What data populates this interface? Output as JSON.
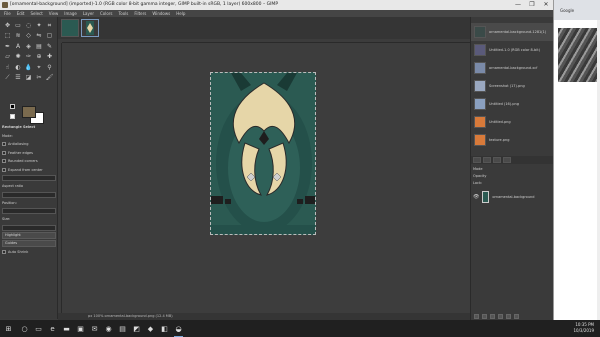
{
  "window": {
    "title": "[ornamental-background] (imported)-1.0 (RGB color 8-bit gamma integer, GIMP built-in sRGB, 1 layer) 600x800 – GIMP",
    "controls": [
      "—",
      "❐",
      "✕"
    ]
  },
  "menubar": {
    "items": [
      "File",
      "Edit",
      "Select",
      "View",
      "Image",
      "Layer",
      "Colors",
      "Tools",
      "Filters",
      "Windows",
      "Help"
    ]
  },
  "colors": {
    "foreground": "#7a6a4e",
    "background": "#ffffff",
    "image_teal": "#2b5a52",
    "image_cream": "#e6d6a8"
  },
  "tool_options": {
    "title": "Rectangle Select",
    "rows": [
      "Mode:",
      "Antialiasing",
      "Feather edges",
      "Rounded corners",
      "Expand from center",
      "Fixed",
      "Aspect ratio",
      "Position:",
      "Size:",
      "Highlight",
      "Guides",
      "Auto Shrink",
      "Shrink merged"
    ]
  },
  "documents": {
    "items": [
      {
        "label": "ornamental-background-1281(1)",
        "thumb": "#3a4a48"
      },
      {
        "label": "Untitled-1.0 (RGB color 8-bit)",
        "thumb": "#5a5a7a"
      },
      {
        "label": "ornamental-background.xcf",
        "thumb": "#7a8aa8"
      },
      {
        "label": "Screenshot (17).png",
        "thumb": "#9aa8c0"
      },
      {
        "label": "Untitled (16).png",
        "thumb": "#8aa0c0"
      },
      {
        "label": "Untitled.png",
        "thumb": "#d87a3a"
      },
      {
        "label": "texture.png",
        "thumb": "#d87a3a"
      }
    ]
  },
  "layers": {
    "mode_label": "Mode",
    "opacity_label": "Opacity",
    "lock_label": "Lock:",
    "layer_name": "ornamental-background"
  },
  "statusbar": {
    "text": "px   100%   ornamental-background.png (12.4 MB)"
  },
  "browser": {
    "tab_label": "Google"
  },
  "taskbar": {
    "time": "10:35 PM",
    "date": "10/3/2019"
  }
}
